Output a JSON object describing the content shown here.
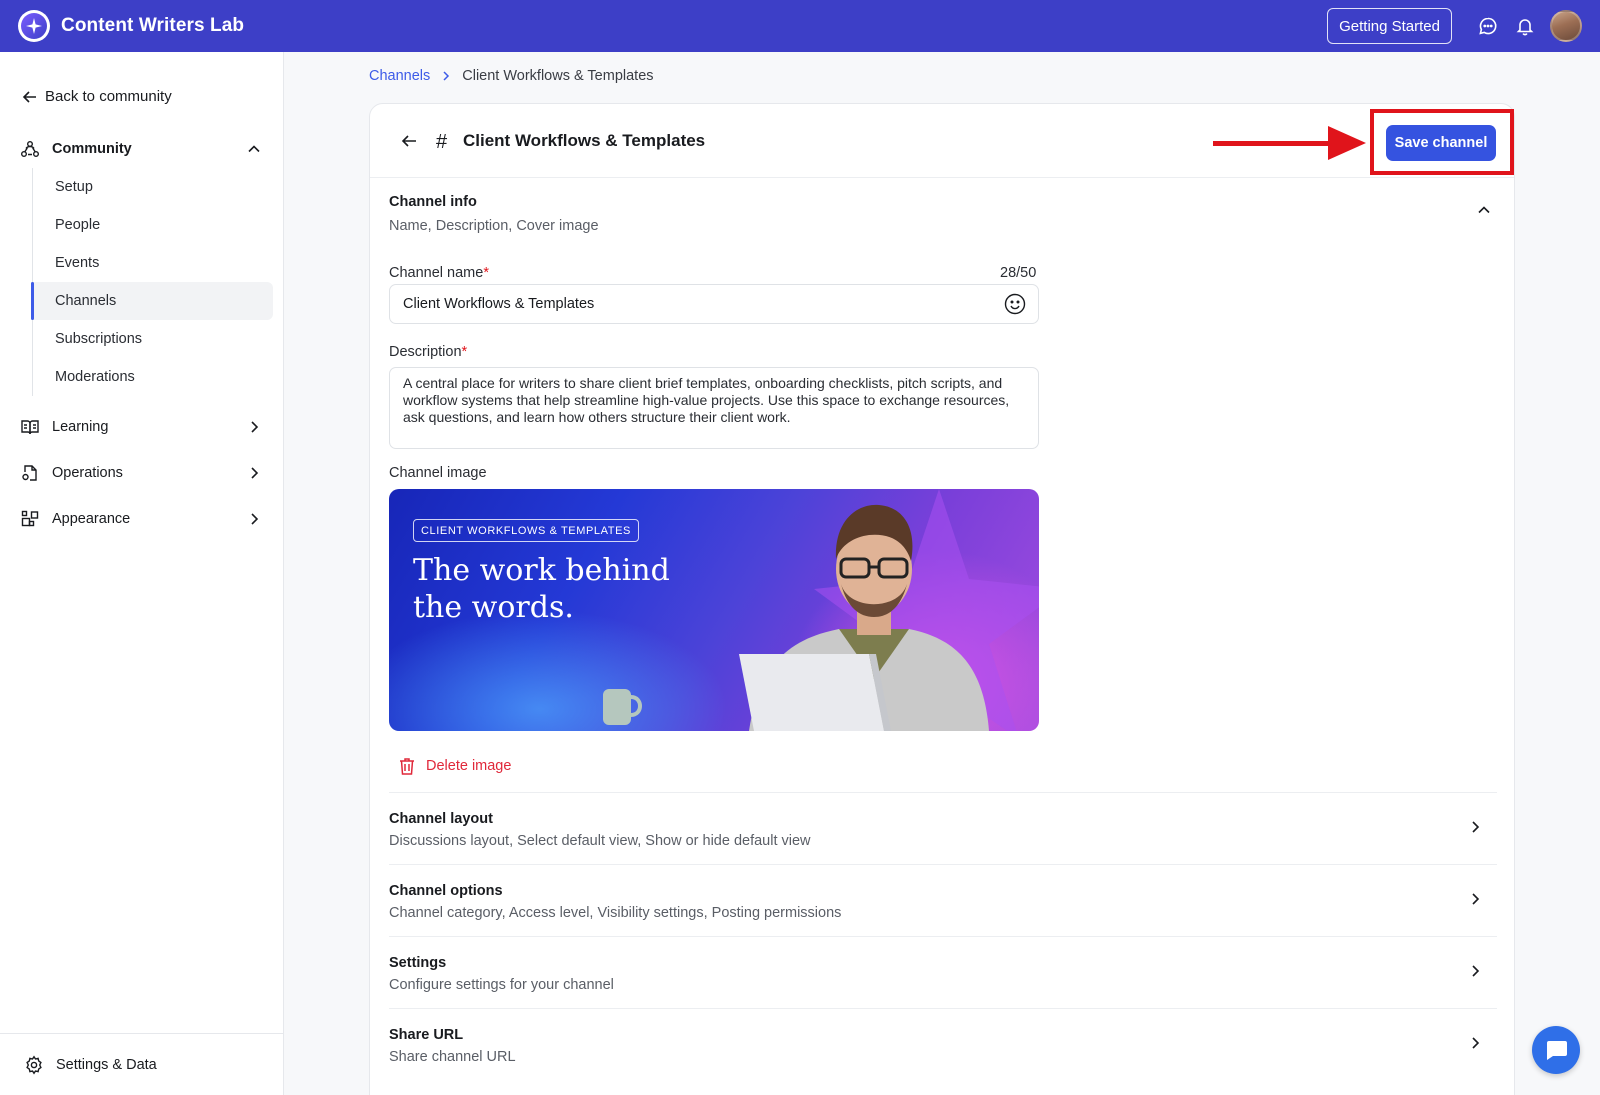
{
  "app": {
    "name": "Content Writers Lab",
    "accent": "#3d3fc7",
    "primary_button": "#3553e0"
  },
  "topbar": {
    "getting_started": "Getting Started",
    "icons": [
      "chat-bubble-icon",
      "bell-icon",
      "user-avatar"
    ]
  },
  "sidebar": {
    "back_label": "Back to community",
    "community": {
      "label": "Community",
      "expanded": true,
      "items": [
        {
          "label": "Setup",
          "active": false
        },
        {
          "label": "People",
          "active": false
        },
        {
          "label": "Events",
          "active": false
        },
        {
          "label": "Channels",
          "active": true
        },
        {
          "label": "Subscriptions",
          "active": false
        },
        {
          "label": "Moderations",
          "active": false
        }
      ]
    },
    "groups": [
      {
        "label": "Learning",
        "icon": "book-icon"
      },
      {
        "label": "Operations",
        "icon": "document-gear-icon"
      },
      {
        "label": "Appearance",
        "icon": "blocks-icon"
      }
    ],
    "footer_label": "Settings & Data"
  },
  "breadcrumb": {
    "parent": "Channels",
    "current": "Client Workflows & Templates"
  },
  "channel": {
    "hash": "#",
    "title": "Client Workflows & Templates",
    "save_label": "Save channel",
    "info": {
      "title": "Channel info",
      "subtitle": "Name, Description, Cover image"
    },
    "name_label": "Channel name",
    "required_mark": "*",
    "name_counter": "28/50",
    "name_value": "Client Workflows & Templates",
    "description_label": "Description",
    "description_value": "A central place for writers to share client brief templates, onboarding checklists, pitch scripts, and workflow systems that help streamline high-value projects. Use this space to exchange resources, ask questions, and learn how others structure their client work.",
    "image_label": "Channel image",
    "cover": {
      "tag": "CLIENT WORKFLOWS & TEMPLATES",
      "headline_line1": "The work behind",
      "headline_line2": "the words."
    },
    "delete_image_label": "Delete image"
  },
  "sections": [
    {
      "title": "Channel layout",
      "subtitle": "Discussions layout, Select default view, Show or hide default view"
    },
    {
      "title": "Channel options",
      "subtitle": "Channel category, Access level, Visibility settings, Posting permissions"
    },
    {
      "title": "Settings",
      "subtitle": "Configure settings for your channel"
    },
    {
      "title": "Share URL",
      "subtitle": "Share channel URL"
    }
  ]
}
